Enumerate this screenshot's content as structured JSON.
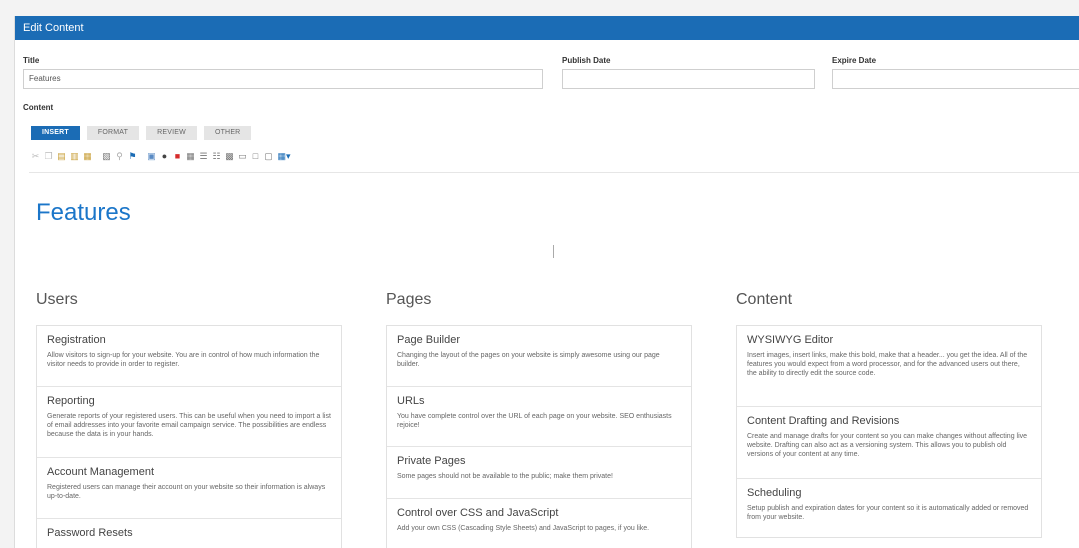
{
  "header": {
    "title": "Edit Content"
  },
  "fields": {
    "title_label": "Title",
    "title_value": "Features",
    "publish_label": "Publish Date",
    "publish_value": "",
    "expire_label": "Expire Date",
    "expire_value": "",
    "content_label": "Content"
  },
  "tabs": [
    {
      "label": "INSERT",
      "active": true
    },
    {
      "label": "FORMAT",
      "active": false
    },
    {
      "label": "REVIEW",
      "active": false
    },
    {
      "label": "OTHER",
      "active": false
    }
  ],
  "toolbar_icons": [
    "cut-icon",
    "copy-icon",
    "paste-icon",
    "paste-text-icon",
    "paste-word-icon",
    "paste-special-icon",
    "find-icon",
    "anchor-flag-icon",
    "image-icon",
    "lock-icon",
    "media-icon",
    "table-icon",
    "insert-row-icon",
    "horizontal-rule-icon",
    "template-icon",
    "iframe-icon",
    "box-icon",
    "embed-icon",
    "grid-dropdown-icon"
  ],
  "editor": {
    "heading": "Features",
    "columns": [
      {
        "title": "Users",
        "items": [
          {
            "title": "Registration",
            "desc": "Allow visitors to sign-up for your website. You are in control of how much information the visitor needs to provide in order to register."
          },
          {
            "title": "Reporting",
            "desc": "Generate reports of your registered users. This can be useful when you need to import a list of email addresses into your favorite email campaign service. The possibilities are endless because the data is in your hands."
          },
          {
            "title": "Account Management",
            "desc": "Registered users can manage their account on your website so their information is always up-to-date."
          },
          {
            "title": "Password Resets",
            "desc": ""
          }
        ]
      },
      {
        "title": "Pages",
        "items": [
          {
            "title": "Page Builder",
            "desc": "Changing the layout of the pages on your website is simply awesome using our page builder."
          },
          {
            "title": "URLs",
            "desc": "You have complete control over the URL of each page on your website. SEO enthusiasts rejoice!"
          },
          {
            "title": "Private Pages",
            "desc": "Some pages should not be available to the public; make them private!"
          },
          {
            "title": "Control over CSS and JavaScript",
            "desc": "Add your own CSS (Cascading Style Sheets) and JavaScript to pages, if you like."
          }
        ]
      },
      {
        "title": "Content",
        "items": [
          {
            "title": "WYSIWYG Editor",
            "desc": "Insert images, insert links, make this bold, make that a header... you get the idea. All of the features you would expect from a word processor, and for the advanced users out there, the ability to directly edit the source code."
          },
          {
            "title": "Content Drafting and Revisions",
            "desc": "Create and manage drafts for your content so you can make changes without affecting live website. Drafting can also act as a versioning system. This allows you to publish old versions of your content at any time."
          },
          {
            "title": "Scheduling",
            "desc": "Setup publish and expiration dates for your content so it is automatically added or removed from your website."
          }
        ]
      }
    ]
  }
}
